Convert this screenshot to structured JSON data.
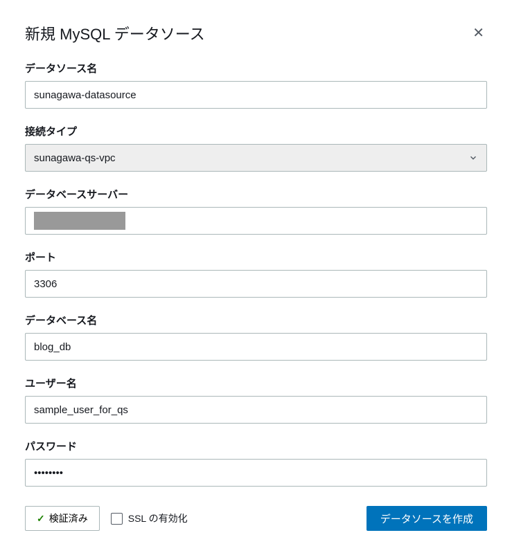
{
  "title": "新規 MySQL データソース",
  "fields": {
    "datasource_name": {
      "label": "データソース名",
      "value": "sunagawa-datasource"
    },
    "connection_type": {
      "label": "接続タイプ",
      "selected": "sunagawa-qs-vpc"
    },
    "database_server": {
      "label": "データベースサーバー",
      "value": ""
    },
    "port": {
      "label": "ポート",
      "value": "3306"
    },
    "database_name": {
      "label": "データベース名",
      "value": "blog_db"
    },
    "username": {
      "label": "ユーザー名",
      "value": "sample_user_for_qs"
    },
    "password": {
      "label": "パスワード",
      "value": "••••••••"
    }
  },
  "footer": {
    "validated_label": "検証済み",
    "ssl_label": "SSL の有効化",
    "create_label": "データソースを作成"
  }
}
